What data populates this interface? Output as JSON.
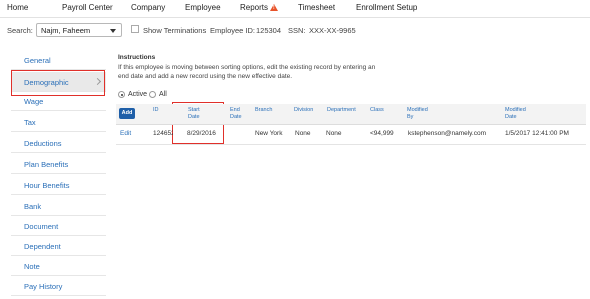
{
  "nav": {
    "items": [
      "Home",
      "Payroll Center",
      "Company",
      "Employee",
      "Reports",
      "Timesheet",
      "Enrollment Setup"
    ],
    "reports_alert_icon": "warning-triangle-icon",
    "alert_color": "#e8532a"
  },
  "filters": {
    "search_label": "Search:",
    "employee_value": "Najm, Faheem",
    "show_terminations_label": "Show Terminations",
    "employee_id_label": "Employee ID:",
    "employee_id_value": "125304",
    "ssn_label": "SSN:",
    "ssn_value": "XXX-XX-9965"
  },
  "sidebar": {
    "items": [
      {
        "label": "General"
      },
      {
        "label": "Demographic",
        "active": true
      },
      {
        "label": "Wage"
      },
      {
        "label": "Tax"
      },
      {
        "label": "Deductions"
      },
      {
        "label": "Plan Benefits"
      },
      {
        "label": "Hour Benefits"
      },
      {
        "label": "Bank"
      },
      {
        "label": "Document"
      },
      {
        "label": "Dependent"
      },
      {
        "label": "Note"
      },
      {
        "label": "Pay History"
      }
    ]
  },
  "instructions": {
    "title": "Instructions",
    "text": "If this employee is moving between sorting options, edit the existing record by entering an end date and add a new record using the new effective date."
  },
  "filter_radio": {
    "active_label": "Active",
    "all_label": "All",
    "selected": "Active"
  },
  "table": {
    "add_label": "Add",
    "headers": {
      "id": "ID",
      "start_date": [
        "Start",
        "Date"
      ],
      "end_date": [
        "End",
        "Date"
      ],
      "branch": "Branch",
      "division": "Division",
      "department": "Department",
      "class": "Class",
      "modified_by": [
        "Modified",
        "By"
      ],
      "modified_date": "Modified\nDate"
    },
    "rows": [
      {
        "action": "Edit",
        "id": "124652",
        "start_date": "8/29/2016",
        "end_date": "",
        "branch": "New York",
        "division": "None",
        "department": "None",
        "class": "<94,999",
        "modified_by": "kstephenson@namely.com",
        "modified_date": "1/5/2017 12:41:00 PM"
      }
    ]
  },
  "colors": {
    "link": "#2a6fb8",
    "highlight": "#e0302a",
    "primary_button": "#1f5fa8"
  }
}
